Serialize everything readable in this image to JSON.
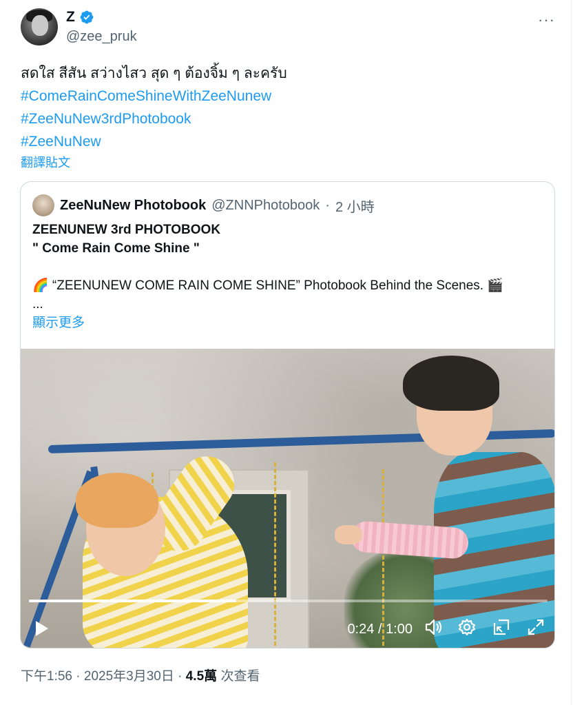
{
  "author": {
    "display_name": "Z",
    "handle": "@zee_pruk"
  },
  "more_label": "···",
  "tweet": {
    "text": "สดใส สีสัน สว่างไสว สุด ๆ ต้องจิ้ม ๆ ละครับ",
    "hashtags": [
      "#ComeRainComeShineWithZeeNunew",
      "#ZeeNuNew3rdPhotobook",
      "#ZeeNuNew"
    ],
    "translate_label": "翻譯貼文"
  },
  "quoted": {
    "name": "ZeeNuNew Photobook",
    "handle": "@ZNNPhotobook",
    "separator": "·",
    "time": "2 小時",
    "title_line1": "ZEENUNEW 3rd PHOTOBOOK",
    "title_line2": "\" Come Rain Come Shine \"",
    "body": "🌈 “ZEENUNEW COME RAIN COME SHINE” Photobook Behind the Scenes. 🎬",
    "ellipsis": "...",
    "show_more": "顯示更多",
    "video": {
      "current_time": "0:24",
      "duration": "1:00",
      "time_separator": "/",
      "progress_fraction": 0.4
    }
  },
  "meta": {
    "time": "下午1:56",
    "dot": "·",
    "date": "2025年3月30日",
    "views_count": "4.5萬",
    "views_label": "次查看"
  },
  "colors": {
    "link": "#1d9bf0",
    "secondary_text": "#536471",
    "verified": "#1d9bf0"
  }
}
